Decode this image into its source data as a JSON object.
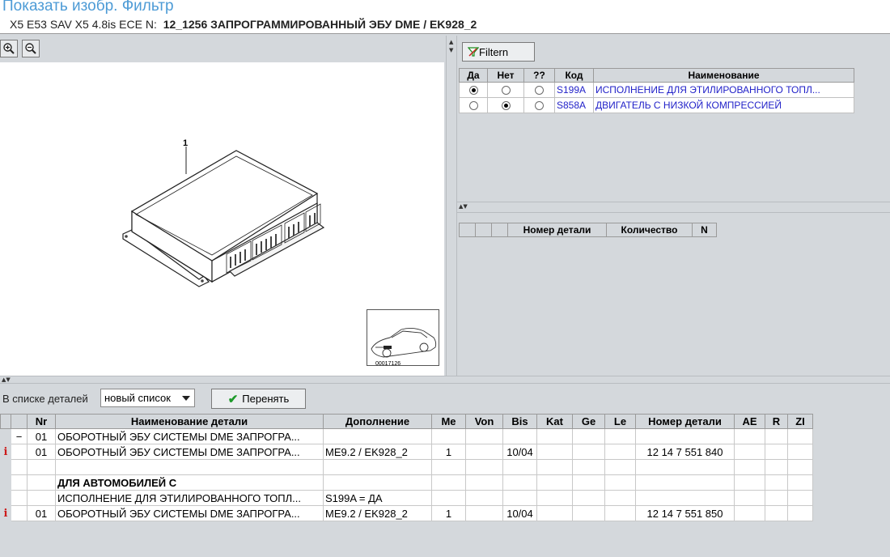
{
  "header": {
    "title": "Показать изобр. Фильтр",
    "vehicle": "X5 E53 SAV X5 4.8is ECE  N:",
    "group": "12_1256 ЗАПРОГРАММИРОВАННЫЙ ЭБУ DME / EK928_2"
  },
  "image": {
    "part_number": "1",
    "thumb_id": "00017126"
  },
  "filter": {
    "button_label": "Filtern",
    "columns": [
      "Да",
      "Нет",
      "??",
      "Код",
      "Наименование"
    ],
    "rows": [
      {
        "yes": true,
        "no": false,
        "unknown": false,
        "code": "S199A",
        "name": "ИСПОЛНЕНИЕ ДЛЯ ЭТИЛИРОВАННОГО ТОПЛ..."
      },
      {
        "yes": false,
        "no": true,
        "unknown": false,
        "code": "S858A",
        "name": "ДВИГАТЕЛЬ С НИЗКОЙ КОМПРЕССИЕЙ"
      }
    ]
  },
  "result": {
    "columns": [
      "",
      "",
      "",
      "Номер детали",
      "Количество",
      "N"
    ]
  },
  "parts": {
    "list_label": "В списке деталей",
    "list_value": "новый список",
    "apply_label": "Перенять",
    "columns": [
      "",
      "",
      "Nr",
      "Наименование детали",
      "Дополнение",
      "Me",
      "Von",
      "Bis",
      "Kat",
      "Ge",
      "Le",
      "Номер детали",
      "AE",
      "R",
      "ZI"
    ],
    "rows": [
      {
        "info": "",
        "mark": "−",
        "nr": "01",
        "name": "ОБОРОТНЫЙ ЭБУ СИСТЕМЫ DME ЗАПРОГРА...",
        "suppl": "",
        "me": "",
        "von": "",
        "bis": "",
        "part_no": "",
        "bold": false
      },
      {
        "info": "i",
        "mark": "",
        "nr": "01",
        "name": "ОБОРОТНЫЙ ЭБУ СИСТЕМЫ DME ЗАПРОГРА...",
        "suppl": "ME9.2 / EK928_2",
        "me": "1",
        "von": "",
        "bis": "10/04",
        "part_no": "12 14 7 551 840",
        "bold": false
      },
      {
        "info": "",
        "mark": "",
        "nr": "",
        "name": "",
        "suppl": "",
        "me": "",
        "von": "",
        "bis": "",
        "part_no": "",
        "bold": false
      },
      {
        "info": "",
        "mark": "",
        "nr": "",
        "name": "ДЛЯ АВТОМОБИЛЕЙ С",
        "suppl": "",
        "me": "",
        "von": "",
        "bis": "",
        "part_no": "",
        "bold": true
      },
      {
        "info": "",
        "mark": "",
        "nr": "",
        "name": "ИСПОЛНЕНИЕ ДЛЯ ЭТИЛИРОВАННОГО ТОПЛ...",
        "suppl": "S199A = ДА",
        "me": "",
        "von": "",
        "bis": "",
        "part_no": "",
        "bold": false
      },
      {
        "info": "i",
        "mark": "",
        "nr": "01",
        "name": "ОБОРОТНЫЙ ЭБУ СИСТЕМЫ DME ЗАПРОГРА...",
        "suppl": "ME9.2 / EK928_2",
        "me": "1",
        "von": "",
        "bis": "10/04",
        "part_no": "12 14 7 551 850",
        "bold": false
      }
    ]
  }
}
